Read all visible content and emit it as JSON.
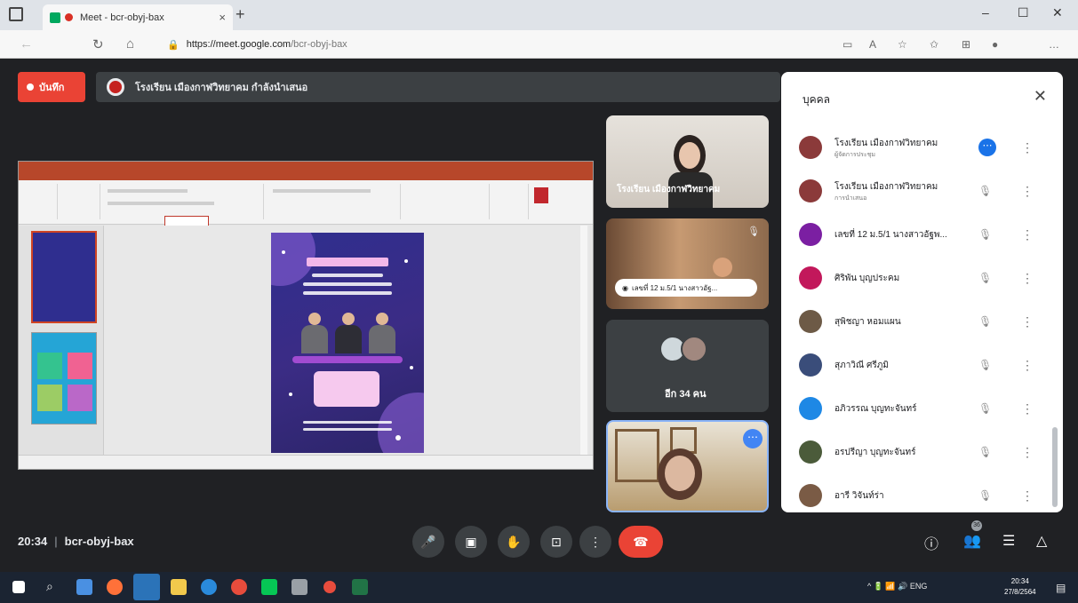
{
  "browser": {
    "tab_title": "Meet - bcr-obyj-bax",
    "tab_close": "×",
    "new_tab": "+",
    "url_host": "https://meet.google.com",
    "url_path": "/bcr-obyj-bax",
    "window_controls": {
      "minimize": "–",
      "maximize": "☐",
      "close": "✕"
    }
  },
  "meet": {
    "record_label": "บันทึก",
    "presenting_text": "โรงเรียน เมืองกาฬวิทยาคม กำลังนำเสนอ",
    "tiles": {
      "tile1_name": "โรงเรียน เมืองกาฬวิทยาคม",
      "tile2_pill": "เลขที่ 12 ม.5/1 นางสาวอัฐ...",
      "tile3_label": "อีก 34 คน",
      "more_glyph": "⋯"
    },
    "meeting_time": "20:34",
    "meeting_code": "bcr-obyj-bax",
    "separator": "|"
  },
  "people_panel": {
    "title": "บุคคล",
    "close": "✕",
    "rows": [
      {
        "name": "โรงเรียน เมืองกาฬวิทยาคม",
        "sub": "ผู้จัดการประชุม",
        "color": "#8b3a3a",
        "state": "more"
      },
      {
        "name": "โรงเรียน เมืองกาฬวิทยาคม",
        "sub": "การนำเสนอ",
        "color": "#8b3a3a",
        "state": "muted"
      },
      {
        "name": "เลขที่ 12 ม.5/1 นางสาวอัฐพ...",
        "sub": "",
        "color": "#7b1fa2",
        "state": "muted"
      },
      {
        "name": "ศิริพัน บุญประคม",
        "sub": "",
        "color": "#c2185b",
        "state": "muted"
      },
      {
        "name": "สุพิชญา หอมแผน",
        "sub": "",
        "color": "#6d5a46",
        "state": "muted"
      },
      {
        "name": "สุภาวิณี ศรีภูมิ",
        "sub": "",
        "color": "#3a4d7a",
        "state": "muted"
      },
      {
        "name": "อภิวรรณ บุญทะจันทร์",
        "sub": "",
        "color": "#1e88e5",
        "state": "muted"
      },
      {
        "name": "อรปรีญา บุญทะจันทร์",
        "sub": "",
        "color": "#4b5b3a",
        "state": "muted"
      },
      {
        "name": "อารี วิจันท์ร่า",
        "sub": "",
        "color": "#7a5b45",
        "state": "muted"
      }
    ],
    "more_glyph": "⋮",
    "blue_glyph": "⋯",
    "mic_off_glyph": "🎙"
  },
  "controls": {
    "mic": "🎤",
    "camera": "▣",
    "hand": "✋",
    "present": "⊡",
    "more": "⋮",
    "end": "☎",
    "info": "ⓘ",
    "people": "👥",
    "chat": "☰",
    "activities": "△",
    "people_badge": "36"
  },
  "taskbar": {
    "tray_text": "^  🔋 📶 🔊 ENG",
    "time": "20:34",
    "date": "27/8/2564",
    "lang": "ENG"
  },
  "colors": {
    "record_red": "#ea4335",
    "meet_bg": "#202124",
    "accent_blue": "#1a73e8"
  }
}
